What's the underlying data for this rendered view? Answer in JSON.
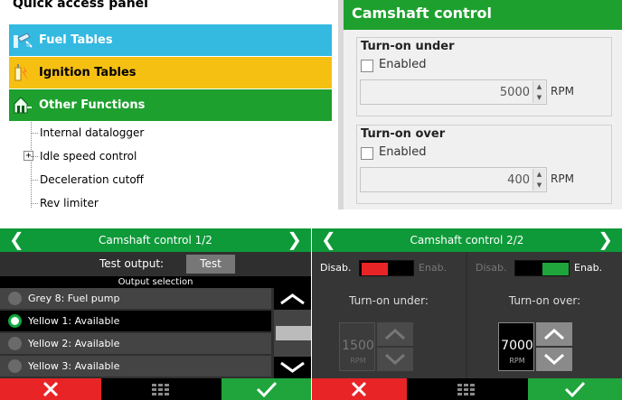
{
  "quick_access": {
    "title": "Quick access panel",
    "categories": [
      {
        "label": "Fuel Tables",
        "color": "#34b9e1"
      },
      {
        "label": "Ignition Tables",
        "color": "#f5c012"
      },
      {
        "label": "Other Functions",
        "color": "#1ea02e"
      }
    ],
    "tree_items": [
      {
        "label": "Internal datalogger",
        "expandable": false
      },
      {
        "label": "Idle speed control",
        "expandable": true,
        "expander": "+"
      },
      {
        "label": "Deceleration cutoff",
        "expandable": false
      },
      {
        "label": "Rev limiter",
        "expandable": false
      }
    ]
  },
  "camshaft_panel": {
    "title": "Camshaft control",
    "accent": "#1ea02e",
    "turn_on_under": {
      "title": "Turn-on under",
      "checkbox_label": "Enabled",
      "checked": false,
      "value": "5000",
      "unit": "RPM"
    },
    "turn_on_over": {
      "title": "Turn-on over",
      "checkbox_label": "Enabled",
      "checked": false,
      "value": "400",
      "unit": "RPM"
    }
  },
  "device_screen_1": {
    "title": "Camshaft control 1/2",
    "test_output_label": "Test output:",
    "test_button": "Test",
    "output_selection_label": "Output selection",
    "outputs": [
      {
        "label": "Grey 8: Fuel pump",
        "selected": false
      },
      {
        "label": "Yellow 1: Available",
        "selected": true
      },
      {
        "label": "Yellow 2: Available",
        "selected": false
      },
      {
        "label": "Yellow 3: Available",
        "selected": false
      }
    ],
    "scroll_position": 0.5
  },
  "device_screen_2": {
    "title": "Camshaft control 2/2",
    "left": {
      "disable_label": "Disab.",
      "enable_label": "Enab.",
      "state": "disabled",
      "toggle_color": "#e82427",
      "setting_label": "Turn-on under:",
      "value": "1500",
      "unit": "RPM"
    },
    "right": {
      "disable_label": "Disab.",
      "enable_label": "Enab.",
      "state": "enabled",
      "toggle_color": "#1fa53c",
      "setting_label": "Turn-on over:",
      "value": "7000",
      "unit": "RPM"
    }
  },
  "icons": {
    "prev": "chevron-left-icon",
    "next": "chevron-right-icon",
    "cancel": "x-icon",
    "menu": "grid-icon",
    "confirm": "check-icon"
  },
  "colors": {
    "device_header": "#0e9a39",
    "cancel": "#e82427",
    "confirm": "#1fa53c",
    "fuel": "#34b9e1",
    "ignition": "#f5c012",
    "other": "#1ea02e"
  }
}
